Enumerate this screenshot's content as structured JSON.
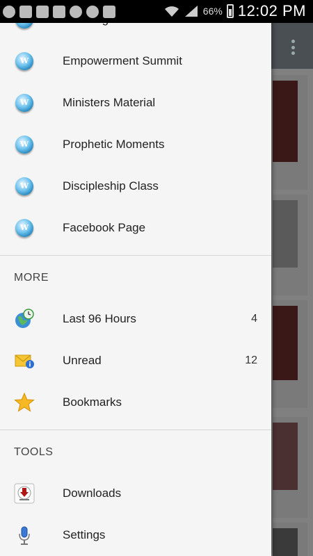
{
  "status_bar": {
    "battery": "66%",
    "time": "12:02 PM",
    "notification_icons": [
      "add-icon",
      "mail-icon",
      "facebook-icon",
      "facebook-icon",
      "whatsapp-icon",
      "zero-badge",
      "mute-icon"
    ]
  },
  "drawer": {
    "feeds": [
      {
        "label": "Amazing Love",
        "icon": "wordpress-icon"
      },
      {
        "label": "Empowerment Summit",
        "icon": "wordpress-icon"
      },
      {
        "label": "Ministers Material",
        "icon": "wordpress-icon"
      },
      {
        "label": "Prophetic Moments",
        "icon": "wordpress-icon"
      },
      {
        "label": "Discipleship Class",
        "icon": "wordpress-icon"
      },
      {
        "label": "Facebook Page",
        "icon": "wordpress-icon"
      }
    ],
    "more": {
      "header": "MORE",
      "items": [
        {
          "label": "Last 96 Hours",
          "count": "4",
          "icon": "globe-clock-icon"
        },
        {
          "label": "Unread",
          "count": "12",
          "icon": "envelope-info-icon"
        },
        {
          "label": "Bookmarks",
          "count": "",
          "icon": "star-icon"
        }
      ]
    },
    "tools": {
      "header": "TOOLS",
      "items": [
        {
          "label": "Downloads",
          "icon": "download-icon"
        },
        {
          "label": "Settings",
          "icon": "microphone-settings-icon"
        }
      ]
    }
  },
  "colors": {
    "drawer_bg": "#f5f5f5",
    "overlay": "#808080",
    "toolbar": "#4a4f54"
  }
}
